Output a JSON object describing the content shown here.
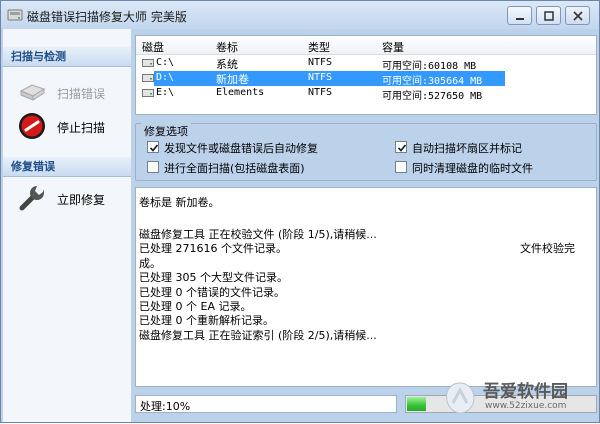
{
  "window": {
    "title": "磁盘错误扫描修复大师 完美版"
  },
  "sidebar": {
    "sections": [
      {
        "header": "扫描与检测",
        "items": [
          {
            "label": "扫描错误",
            "icon": "scan-disk-icon",
            "enabled": false
          },
          {
            "label": "停止扫描",
            "icon": "stop-icon",
            "enabled": true
          }
        ]
      },
      {
        "header": "修复错误",
        "items": [
          {
            "label": "立即修复",
            "icon": "wrench-icon",
            "enabled": true
          }
        ]
      }
    ]
  },
  "drives": {
    "columns": [
      "磁盘",
      "卷标",
      "类型",
      "容量"
    ],
    "rows": [
      {
        "drive": "C:\\",
        "label": "系统",
        "type": "NTFS",
        "capacity": "可用空间:60108 MB",
        "selected": false
      },
      {
        "drive": "D:\\",
        "label": "新加卷",
        "type": "NTFS",
        "capacity": "可用空间:305664 MB",
        "selected": true
      },
      {
        "drive": "E:\\",
        "label": "Elements",
        "type": "NTFS",
        "capacity": "可用空间:527650 MB",
        "selected": false
      }
    ]
  },
  "options": {
    "title": "修复选项",
    "items": [
      {
        "label": "发现文件或磁盘错误后自动修复",
        "checked": true
      },
      {
        "label": "进行全面扫描(包括磁盘表面)",
        "checked": false
      },
      {
        "label": "自动扫描坏扇区并标记",
        "checked": true
      },
      {
        "label": "同时清理磁盘的临时文件",
        "checked": false
      }
    ]
  },
  "log": {
    "lines": [
      "卷标是 新加卷。",
      "",
      "磁盘修复工具 正在校验文件 (阶段 1/5),请稍候...",
      "  已处理 271616 个文件记录。",
      "成。",
      "  已处理 305 个大型文件记录。",
      "  已处理 0 个错误的文件记录。",
      "  已处理 0 个 EA 记录。",
      "  已处理 0 个重新解析记录。",
      "磁盘修复工具 正在验证索引 (阶段 2/5),请稍候..."
    ],
    "right_fragment": "文件校验完"
  },
  "status": {
    "text": "处理:10%",
    "progress_fraction": 0.1
  },
  "watermark": {
    "brand": "吾爱软件园",
    "url": "www.52zixue.com"
  },
  "colors": {
    "selection": "#3399ff",
    "section_header": "#1f4f8a",
    "progress": "#36c236",
    "window_bg": "#bcd1ea"
  }
}
